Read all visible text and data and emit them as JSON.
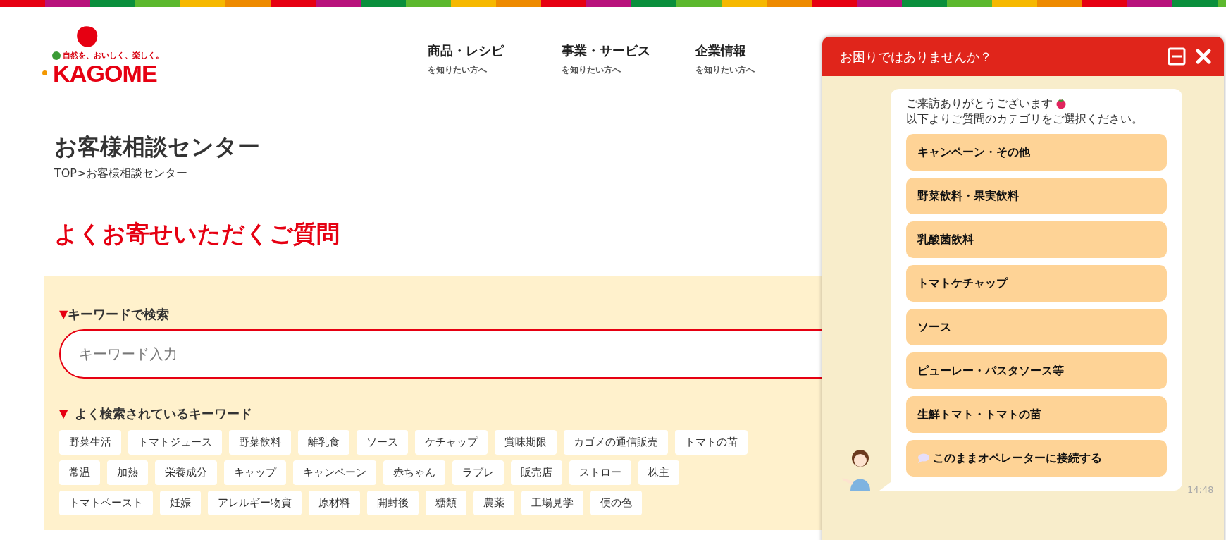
{
  "header": {
    "logo": {
      "tagline": "自然を、おいしく、楽しく。",
      "wordmark": "KAGOME"
    },
    "nav": [
      {
        "label": "商品・レシピ",
        "sub": "を知りたい方へ"
      },
      {
        "label": "事業・サービス",
        "sub": "を知りたい方へ"
      },
      {
        "label": "企業情報",
        "sub": "を知りたい方へ"
      }
    ]
  },
  "page": {
    "title": "お客様相談センター",
    "breadcrumb": "TOP>お客様相談センター",
    "faq_heading": "よくお寄せいただくご質問",
    "search": {
      "marker": "▼",
      "label": "キーワードで検索",
      "placeholder": "キーワード入力"
    },
    "popular": {
      "marker": "▼",
      "label": "よく検索されているキーワード",
      "keywords": [
        "野菜生活",
        "トマトジュース",
        "野菜飲料",
        "離乳食",
        "ソース",
        "ケチャップ",
        "賞味期限",
        "カゴメの通信販売",
        "トマトの苗",
        "常温",
        "加熱",
        "栄養成分",
        "キャップ",
        "キャンペーン",
        "赤ちゃん",
        "ラブレ",
        "販売店",
        "ストロー",
        "株主",
        "トマトペースト",
        "妊娠",
        "アレルギー物質",
        "原材料",
        "開封後",
        "糖類",
        "農薬",
        "工場見学",
        "便の色"
      ]
    }
  },
  "chat": {
    "title": "お困りではありませんか？",
    "message": [
      "ご来訪ありがとうございます",
      "以下よりご質問のカテゴリをご選択ください。"
    ],
    "options": [
      {
        "kind": "category",
        "label": "キャンペーン・その他"
      },
      {
        "kind": "category",
        "label": "野菜飲料・果実飲料"
      },
      {
        "kind": "category",
        "label": "乳酸菌飲料"
      },
      {
        "kind": "category",
        "label": "トマトケチャップ"
      },
      {
        "kind": "category",
        "label": "ソース"
      },
      {
        "kind": "category",
        "label": "ピューレー・パスタソース等"
      },
      {
        "kind": "category",
        "label": "生鮮トマト・トマトの苗"
      },
      {
        "kind": "operator",
        "label": "このままオペレーターに接続する"
      }
    ],
    "time": "14:48"
  }
}
